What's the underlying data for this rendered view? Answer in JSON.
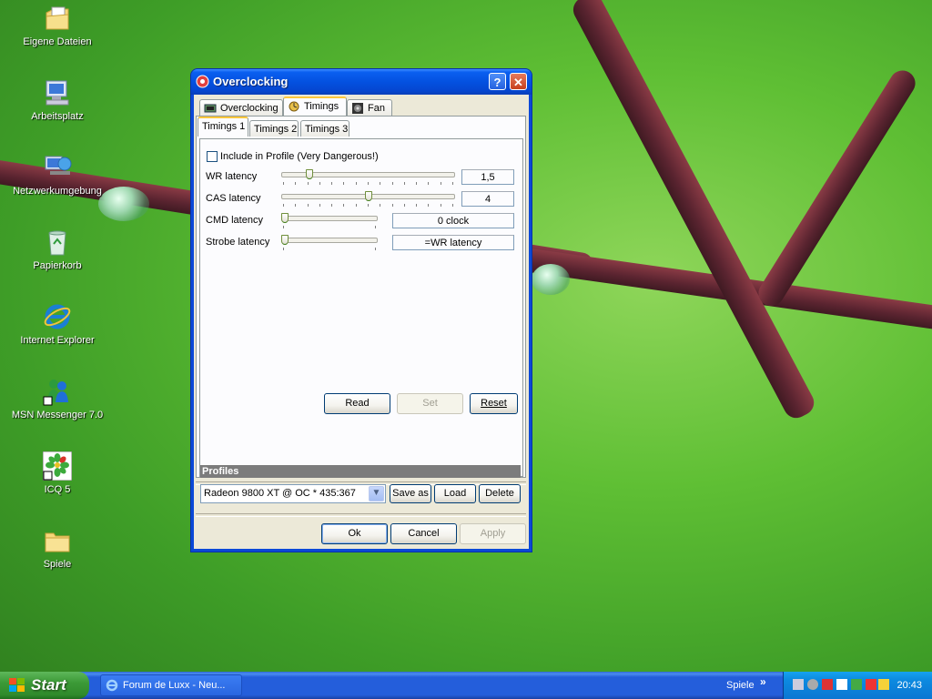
{
  "desktop": {
    "icons": [
      {
        "name": "folder-documents-icon",
        "label": "Eigene Dateien"
      },
      {
        "name": "computer-icon",
        "label": "Arbeitsplatz"
      },
      {
        "name": "network-icon",
        "label": "Netzwerkumgebung"
      },
      {
        "name": "recycle-bin-icon",
        "label": "Papierkorb"
      },
      {
        "name": "internet-explorer-icon",
        "label": "Internet Explorer"
      },
      {
        "name": "msn-messenger-icon",
        "label": "MSN Messenger 7.0"
      },
      {
        "name": "icq-icon",
        "label": "ICQ 5"
      },
      {
        "name": "folder-icon",
        "label": "Spiele"
      }
    ]
  },
  "window": {
    "title": "Overclocking",
    "help_label": "?",
    "close_label": "✕",
    "tabs": [
      {
        "label": "Overclocking",
        "icon": "overclock-icon"
      },
      {
        "label": "Timings",
        "icon": "timings-icon",
        "active": true
      },
      {
        "label": "Fan",
        "icon": "fan-icon"
      }
    ],
    "subtabs": [
      {
        "label": "Timings 1",
        "active": true
      },
      {
        "label": "Timings 2"
      },
      {
        "label": "Timings 3"
      }
    ],
    "include_profile_label": "Include in Profile (Very Dangerous!)",
    "include_profile_checked": false,
    "timings": [
      {
        "label": "WR  latency",
        "value": "1,5",
        "position": 0.15
      },
      {
        "label": "CAS latency",
        "value": "4",
        "position": 0.5
      },
      {
        "label": "CMD latency",
        "value": "0 clock",
        "position": 0.0
      },
      {
        "label": "Strobe latency",
        "value": "=WR latency",
        "position": 0.0
      }
    ],
    "buttons": {
      "read": "Read",
      "set": "Set",
      "reset": "Reset"
    },
    "profiles": {
      "header": "Profiles",
      "selected": "Radeon 9800 XT @ OC * 435:367",
      "save_as": "Save as",
      "load": "Load",
      "delete": "Delete"
    },
    "footer": {
      "ok": "Ok",
      "cancel": "Cancel",
      "apply": "Apply"
    }
  },
  "taskbar": {
    "start_label": "Start",
    "task_label": "Forum de Luxx - Neu...",
    "quick_label": "Spiele",
    "chevron": "»",
    "clock": "20:43"
  },
  "colors": {
    "xp_blue": "#0b49d8",
    "start_green": "#3c9a37",
    "dialog_face": "#ece9d8",
    "tab_highlight": "#ffc83c"
  }
}
